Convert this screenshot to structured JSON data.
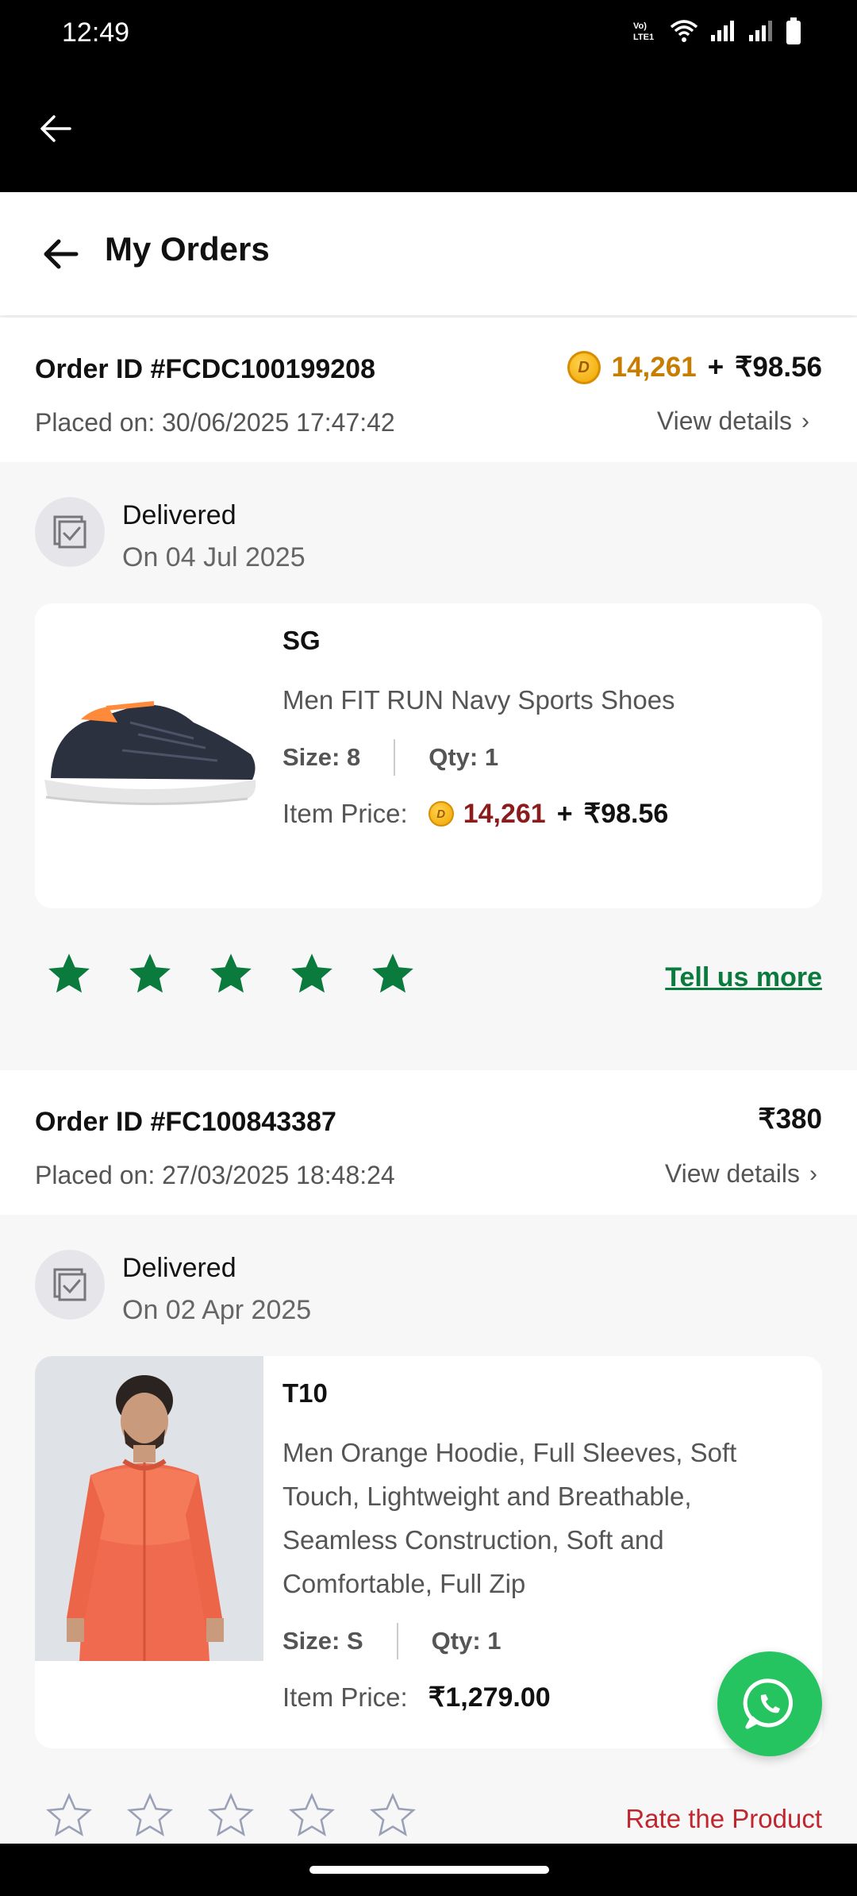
{
  "status_bar": {
    "time": "12:49",
    "network_label": "Vo) LTE1"
  },
  "header": {
    "title": "My Orders"
  },
  "orders": [
    {
      "order_id": "Order ID #FCDC100199208",
      "placed": "Placed on: 30/06/2025 17:47:42",
      "coins": "14,261",
      "plus": "+",
      "amount": "₹98.56",
      "view_details": "View details",
      "status": "Delivered",
      "status_date": "On 04 Jul 2025",
      "item": {
        "brand": "SG",
        "name": "Men FIT RUN Navy Sports Shoes",
        "size": "Size: 8",
        "qty": "Qty: 1",
        "price_label": "Item Price:",
        "price_coins": "14,261",
        "price_plus": "+",
        "price_amount": "₹98.56"
      },
      "rating": 5,
      "rating_action": "Tell us more"
    },
    {
      "order_id": "Order ID #FC100843387",
      "placed": "Placed on: 27/03/2025 18:48:24",
      "amount": "₹380",
      "view_details": "View details",
      "status": "Delivered",
      "status_date": "On 02 Apr 2025",
      "item": {
        "brand": "T10",
        "name": "Men Orange Hoodie, Full Sleeves, Soft Touch, Lightweight and Breathable, Seamless Construction, Soft and Comfortable, Full Zip",
        "size": "Size: S",
        "qty": "Qty: 1",
        "price_label": "Item Price:",
        "price_amount": "₹1,279.00"
      },
      "rating": 0,
      "rating_action": "Rate the Product"
    }
  ],
  "colors": {
    "accent_green": "#0a7a3d",
    "coin_amber": "#c77d00",
    "coin_maroon": "#8b1c1c",
    "rate_red": "#c0262d",
    "whatsapp_green": "#25c461"
  },
  "icons": [
    "back-arrow-icon",
    "wifi-icon",
    "signal-icon",
    "battery-icon",
    "package-check-icon",
    "coin-icon",
    "star-icon",
    "chevron-right-icon",
    "whatsapp-icon"
  ]
}
